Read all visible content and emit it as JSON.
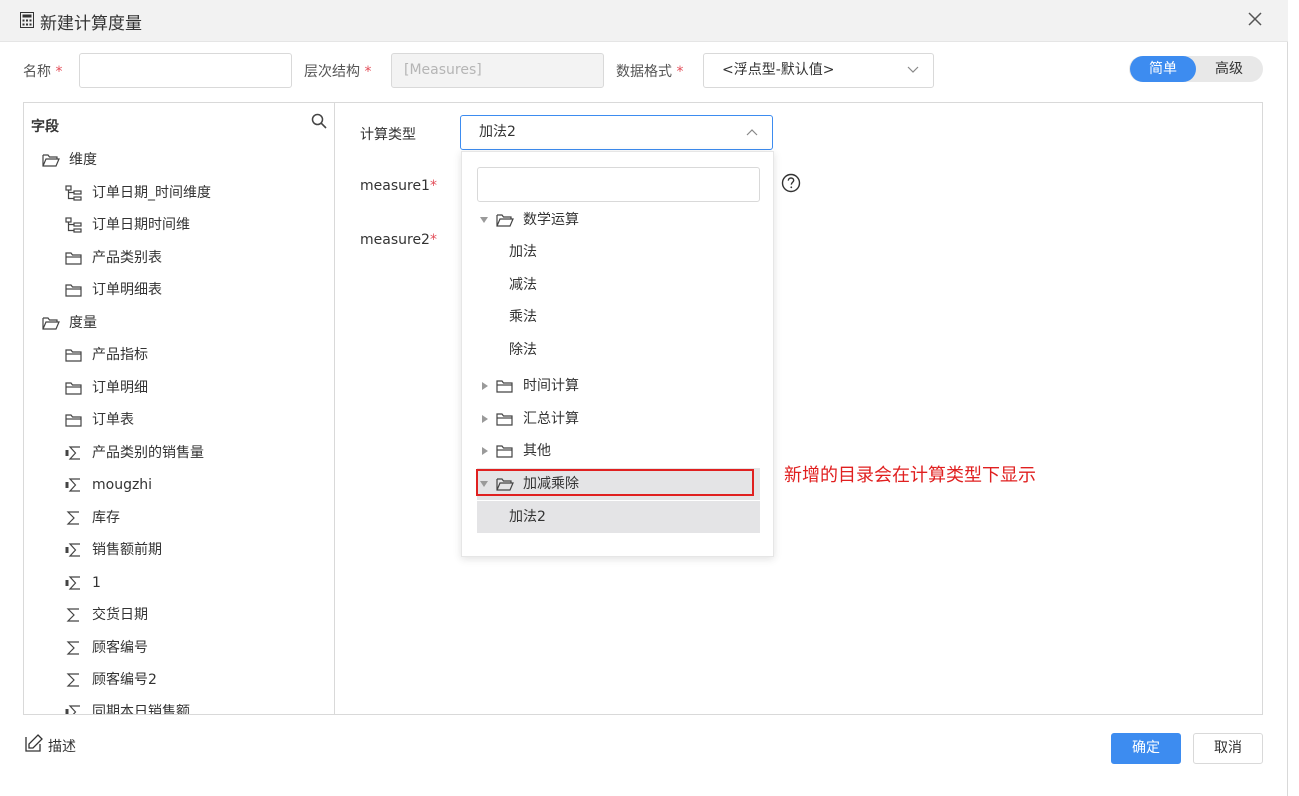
{
  "dialog": {
    "title": "新建计算度量",
    "icon": "calculator-icon",
    "close_icon": "close-icon"
  },
  "form": {
    "name_label": "名称",
    "name_value": "",
    "hierarchy_label": "层次结构",
    "hierarchy_value": "[Measures]",
    "format_label": "数据格式",
    "format_value": "<浮点型-默认值>",
    "required_mark": "*"
  },
  "mode_toggle": {
    "simple": "简单",
    "advanced": "高级",
    "active": "简单"
  },
  "fields_panel": {
    "title": "字段",
    "search_icon": "search-icon",
    "items": [
      {
        "label": "维度",
        "icon": "folder-open-icon",
        "level": 0
      },
      {
        "label": "订单日期_时间维度",
        "icon": "hierarchy-icon",
        "level": 1
      },
      {
        "label": "订单日期时间维",
        "icon": "hierarchy-icon",
        "level": 1
      },
      {
        "label": "产品类别表",
        "icon": "folder-icon",
        "level": 1
      },
      {
        "label": "订单明细表",
        "icon": "folder-icon",
        "level": 1
      },
      {
        "label": "度量",
        "icon": "folder-open-icon",
        "level": 0
      },
      {
        "label": "产品指标",
        "icon": "folder-icon",
        "level": 1
      },
      {
        "label": "订单明细",
        "icon": "folder-icon",
        "level": 1
      },
      {
        "label": "订单表",
        "icon": "folder-icon",
        "level": 1
      },
      {
        "label": "产品类别的销售量",
        "icon": "calc-measure-icon",
        "level": 1
      },
      {
        "label": "mougzhi",
        "icon": "calc-measure-icon",
        "level": 1
      },
      {
        "label": "库存",
        "icon": "sigma-icon",
        "level": 1
      },
      {
        "label": "销售额前期",
        "icon": "calc-measure-icon",
        "level": 1
      },
      {
        "label": "1",
        "icon": "calc-measure-icon",
        "level": 1
      },
      {
        "label": "交货日期",
        "icon": "sigma-icon",
        "level": 1
      },
      {
        "label": "顾客编号",
        "icon": "sigma-icon",
        "level": 1
      },
      {
        "label": "顾客编号2",
        "icon": "sigma-icon",
        "level": 1
      },
      {
        "label": "同期本日销售额",
        "icon": "calc-measure-icon",
        "level": 1
      }
    ]
  },
  "calc": {
    "type_label": "计算类型",
    "type_value": "加法2",
    "measure1_label": "measure1",
    "measure2_label": "measure2",
    "help_icon": "help-icon"
  },
  "dropdown": {
    "search_value": "",
    "rows": [
      {
        "label": "数学运算",
        "kind": "folder",
        "expanded": true
      },
      {
        "label": "加法",
        "kind": "leaf"
      },
      {
        "label": "减法",
        "kind": "leaf"
      },
      {
        "label": "乘法",
        "kind": "leaf"
      },
      {
        "label": "除法",
        "kind": "leaf"
      },
      {
        "label": "时间计算",
        "kind": "folder",
        "expanded": false
      },
      {
        "label": "汇总计算",
        "kind": "folder",
        "expanded": false
      },
      {
        "label": "其他",
        "kind": "folder",
        "expanded": false
      },
      {
        "label": "加减乘除",
        "kind": "folder",
        "expanded": true,
        "highlighted": true
      },
      {
        "label": "加法2",
        "kind": "leaf",
        "selected": true
      }
    ]
  },
  "annotation": "新增的目录会在计算类型下显示",
  "footer": {
    "description": "描述",
    "ok": "确定",
    "cancel": "取消"
  },
  "colors": {
    "primary": "#3d8cf0",
    "annotation": "#e02020",
    "required": "#e34d59"
  }
}
